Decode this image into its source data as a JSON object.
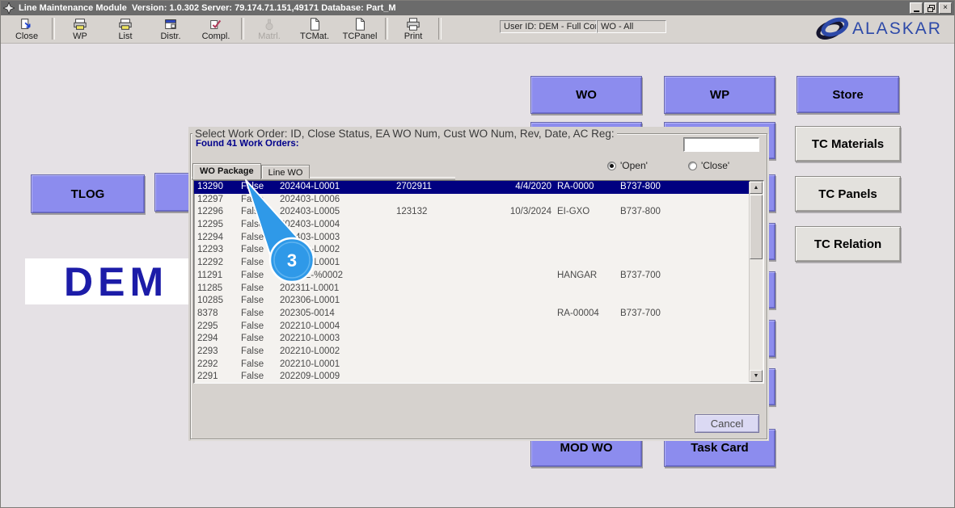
{
  "window": {
    "title": "Line Maintenance Module  Version: 1.0.302 Server: 79.174.71.151,49171 Database: Part_M"
  },
  "toolbar": {
    "buttons": [
      {
        "label": "Close",
        "icon": "exit-icon",
        "enabled": true
      },
      {
        "label": "WP",
        "icon": "printer-icon",
        "enabled": true
      },
      {
        "label": "List",
        "icon": "printer-icon",
        "enabled": true
      },
      {
        "label": "Distr.",
        "icon": "window-icon",
        "enabled": true
      },
      {
        "label": "Compl.",
        "icon": "complete-icon",
        "enabled": true
      },
      {
        "label": "Matrl.",
        "icon": "materials-icon",
        "enabled": false
      },
      {
        "label": "TCMat.",
        "icon": "document-icon",
        "enabled": true
      },
      {
        "label": "TCPanel",
        "icon": "document-icon",
        "enabled": true
      },
      {
        "label": "Print",
        "icon": "print-icon",
        "enabled": true
      }
    ],
    "user_field": "User ID: DEM - Full Control",
    "scope_field": "WO - All",
    "brand": "ALASKAR"
  },
  "main": {
    "wo_button": "WO",
    "wp_button": "WP",
    "store_button": "Store",
    "tc_materials_button": "TC Materials",
    "tc_panels_button": "TC Panels",
    "tc_relation_button": "TC Relation",
    "tlog_button": "TLOG",
    "mod_wo_button": "MOD WO",
    "task_card_button": "Task Card",
    "watermark": "DEM"
  },
  "dialog": {
    "title": "Select Work Order: ID, Close Status, EA WO Num, Cust WO Num, Rev, Date, AC Reg:",
    "found_label": "Found 41 Work Orders:",
    "filter_value": "",
    "tabs": [
      {
        "label": "WO Package",
        "active": true
      },
      {
        "label": "Line WO",
        "active": false
      }
    ],
    "radios": [
      {
        "label": "'Open'",
        "selected": true
      },
      {
        "label": "'Close'",
        "selected": false
      }
    ],
    "cancel_label": "Cancel",
    "selected_index": 0,
    "columns": [
      "ID",
      "Close Status",
      "EA WO Num",
      "Cust WO Num",
      "Rev",
      "Date",
      "AC Reg"
    ],
    "rows": [
      [
        "13290",
        "False",
        "202404-L0001",
        "2702911",
        "4/4/2020",
        "RA-0000",
        "B737-800"
      ],
      [
        "12297",
        "False",
        "202403-L0006",
        "",
        "",
        "",
        ""
      ],
      [
        "12296",
        "False",
        "202403-L0005",
        "123132",
        "10/3/2024",
        "EI-GXO",
        "B737-800"
      ],
      [
        "12295",
        "False",
        "202403-L0004",
        "",
        "",
        "",
        ""
      ],
      [
        "12294",
        "False",
        "202403-L0003",
        "",
        "",
        "",
        ""
      ],
      [
        "12293",
        "False",
        "202403-L0002",
        "",
        "",
        "",
        ""
      ],
      [
        "12292",
        "False",
        "202403-L0001",
        "",
        "",
        "",
        ""
      ],
      [
        "11291",
        "False",
        "202312-%0002",
        "",
        "",
        "HANGAR",
        "B737-700"
      ],
      [
        "11285",
        "False",
        "202311-L0001",
        "",
        "",
        "",
        ""
      ],
      [
        "10285",
        "False",
        "202306-L0001",
        "",
        "",
        "",
        ""
      ],
      [
        "8378",
        "False",
        "202305-0014",
        "",
        "",
        "RA-00004",
        "B737-700"
      ],
      [
        "2295",
        "False",
        "202210-L0004",
        "",
        "",
        "",
        ""
      ],
      [
        "2294",
        "False",
        "202210-L0003",
        "",
        "",
        "",
        ""
      ],
      [
        "2293",
        "False",
        "202210-L0002",
        "",
        "",
        "",
        ""
      ],
      [
        "2292",
        "False",
        "202210-L0001",
        "",
        "",
        "",
        ""
      ],
      [
        "2291",
        "False",
        "202209-L0009",
        "",
        "",
        "",
        ""
      ]
    ]
  },
  "callout": {
    "number": "3",
    "color": "#2f99e8"
  },
  "icons": {
    "scroll_up": "▲",
    "scroll_down": "▼",
    "close_window": "×"
  },
  "colors": {
    "accent_button": "#8c8cee",
    "selected_row": "#000080",
    "brand_blue": "#2d49a8",
    "titlebar": "#6b6b6b"
  }
}
